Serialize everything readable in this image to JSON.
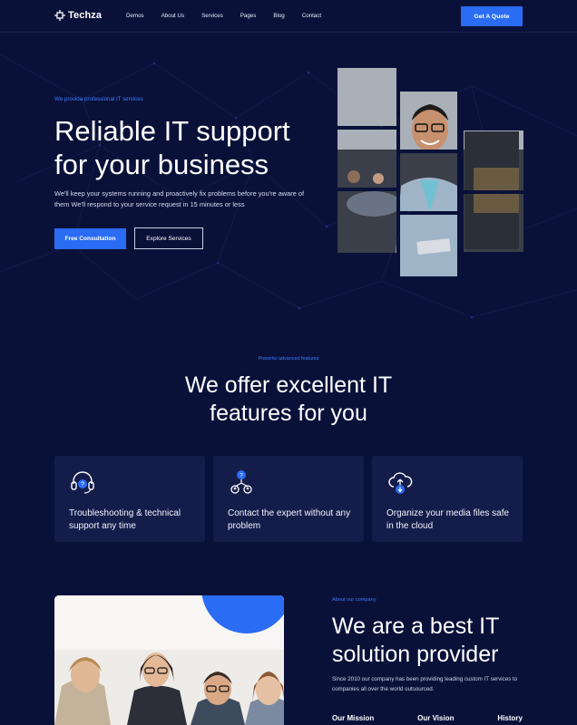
{
  "nav": {
    "logo": "Techza",
    "items": [
      "Demos",
      "About Us",
      "Services",
      "Pages",
      "Blog",
      "Contact"
    ],
    "cta": "Get A Quote"
  },
  "hero": {
    "kicker": "We provide professional IT services",
    "title": "Reliable IT support for your business",
    "description": "We'll keep your systems running and proactively fix problems before you're aware of them We'll respond to your service request in 15 minutes or less",
    "primary_button": "Free Consultation",
    "secondary_button": "Explore Services"
  },
  "features": {
    "kicker": "Powerful advanced features",
    "title_line1": "We offer excellent IT",
    "title_line2": "features for you",
    "cards": [
      {
        "icon": "headset-icon",
        "text": "Troubleshooting & technical support any time"
      },
      {
        "icon": "expert-network-icon",
        "text": "Contact the expert without any problem"
      },
      {
        "icon": "cloud-upload-icon",
        "text": "Organize your media files safe in the cloud"
      }
    ]
  },
  "about": {
    "kicker": "About our company",
    "title": "We are a best IT solution provider",
    "description": "Since 2010 our company has been providing leading custom IT services to companies all over the world outsourced.",
    "tabs": [
      "Our Mission",
      "Our Vision",
      "History"
    ]
  },
  "colors": {
    "background": "#0a1139",
    "accent": "#2a6cf3",
    "card": "#141d4a"
  }
}
